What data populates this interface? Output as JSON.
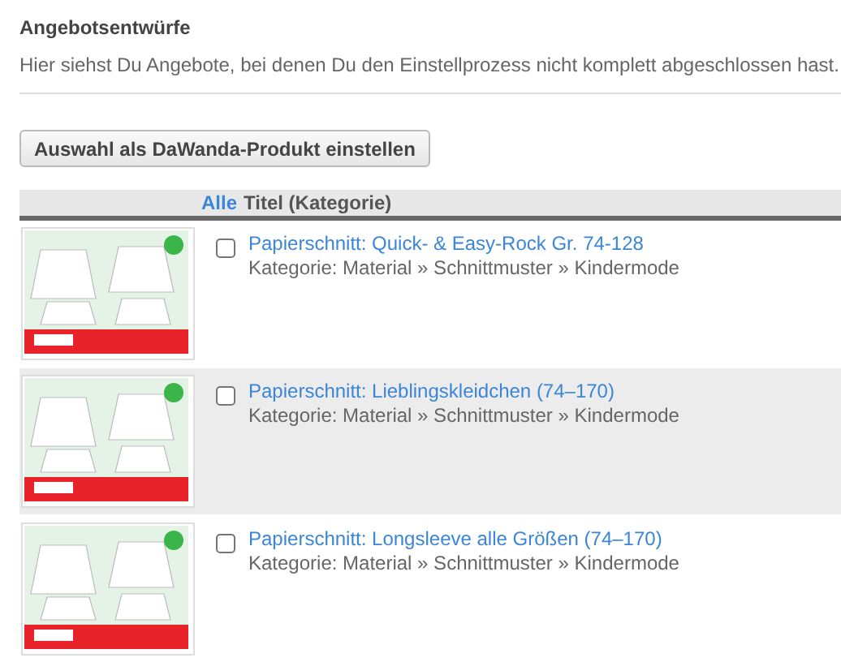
{
  "heading": "Angebotsentwürfe",
  "description": "Hier siehst Du Angebote, bei denen Du den Einstellprozess nicht komplett abgeschlossen hast.",
  "action_button": "Auswahl als DaWanda-Produkt einstellen",
  "table": {
    "select_all": "Alle",
    "column_title": "Titel (Kategorie)",
    "rows": [
      {
        "title": "Papierschnitt: Quick- & Easy-Rock Gr. 74-128",
        "category": "Kategorie: Material » Schnittmuster » Kindermode",
        "checked": false
      },
      {
        "title": "Papierschnitt: Lieblingskleidchen (74–170)",
        "category": "Kategorie: Material » Schnittmuster » Kindermode",
        "checked": false
      },
      {
        "title": "Papierschnitt: Longsleeve alle Größen (74–170)",
        "category": "Kategorie: Material » Schnittmuster » Kindermode",
        "checked": false
      }
    ]
  }
}
